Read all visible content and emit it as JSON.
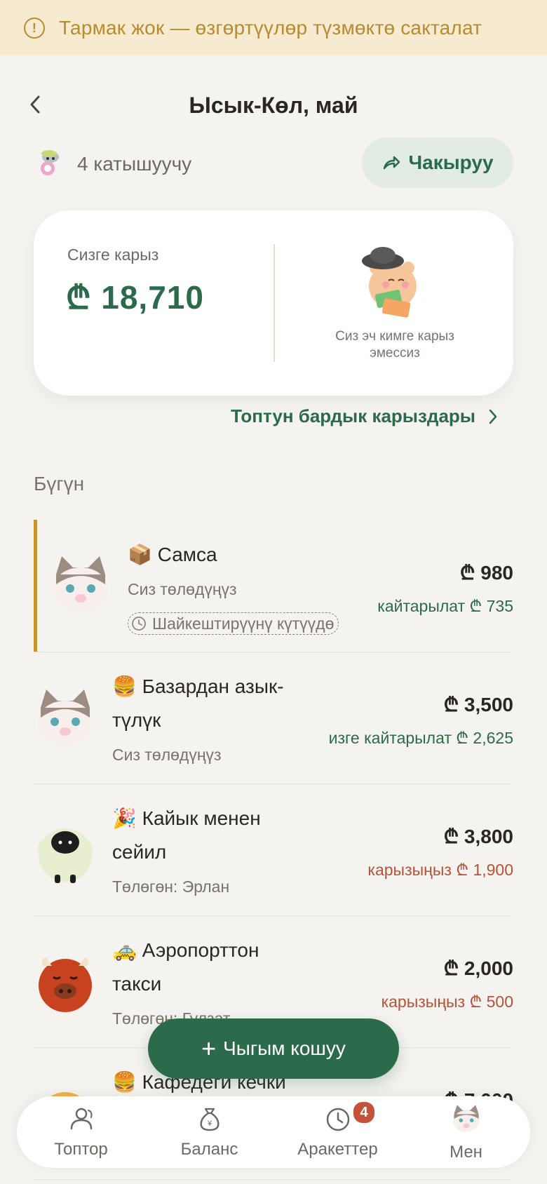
{
  "banner": {
    "icon": "warning-circle-icon",
    "text": "Тармак жок — өзгөртүүлөр түзмөктө сакталат"
  },
  "header": {
    "title": "Ысык-Көл, май",
    "back_icon": "chevron-left-icon"
  },
  "members": {
    "count_label": "4 катышуучу"
  },
  "invite": {
    "label": "Чакыруу",
    "icon": "share-arrow-icon"
  },
  "balance_card": {
    "owed_label": "Сизге карыз",
    "owed_amount": "₾ 18,710",
    "no_debt_line1": "Сиз эч кимге карыз",
    "no_debt_line2": "эмессиз"
  },
  "all_debts_link": "Топтун бардык карыздары",
  "section_today": "Бүгүн",
  "expenses": [
    {
      "emoji": "📦",
      "title": "Самса",
      "subtitle": "Сиз төлөдүңүз",
      "amount": "₾ 980",
      "note": "кайтарылат ₾ 735",
      "note_type": "owed_to_you",
      "pending": "Шайкештирүүнү күтүүдө"
    },
    {
      "emoji": "🍔",
      "title_line1": "Базардан азык-",
      "title_line2": "түлүк",
      "subtitle": "Сиз төлөдүңүз",
      "amount": "₾ 3,500",
      "note": "изге кайтарылат ₾ 2,625",
      "note_type": "owed_to_you"
    },
    {
      "emoji": "🎉",
      "title_line1": "Кайык менен",
      "title_line2": "сейил",
      "subtitle": "Төлөгөн: Эрлан",
      "amount": "₾ 3,800",
      "note": "карызыңыз ₾ 1,900",
      "note_type": "you_owe"
    },
    {
      "emoji": "🚕",
      "title_line1": "Аэропорттон",
      "title_line2": "такси",
      "subtitle": "Төлөгөн: Гулзат",
      "amount": "₾ 2,000",
      "note": "карызыңыз ₾ 500",
      "note_type": "you_owe"
    },
    {
      "emoji": "🍔",
      "title_line1": "Кафедеги кечки",
      "amount": "₾ 7,000"
    }
  ],
  "fab": {
    "label": "Чыгым кошуу"
  },
  "tabs": [
    {
      "label": "Топтор",
      "icon": "people-icon"
    },
    {
      "label": "Баланс",
      "icon": "money-bag-icon"
    },
    {
      "label": "Аракеттер",
      "icon": "clock-icon",
      "badge": "4"
    },
    {
      "label": "Мен",
      "icon": "cat-avatar-icon"
    }
  ],
  "colors": {
    "accent": "#2b6a4b",
    "warning": "#b98b2c",
    "negative": "#b5533a",
    "background": "#f5f3ef"
  }
}
